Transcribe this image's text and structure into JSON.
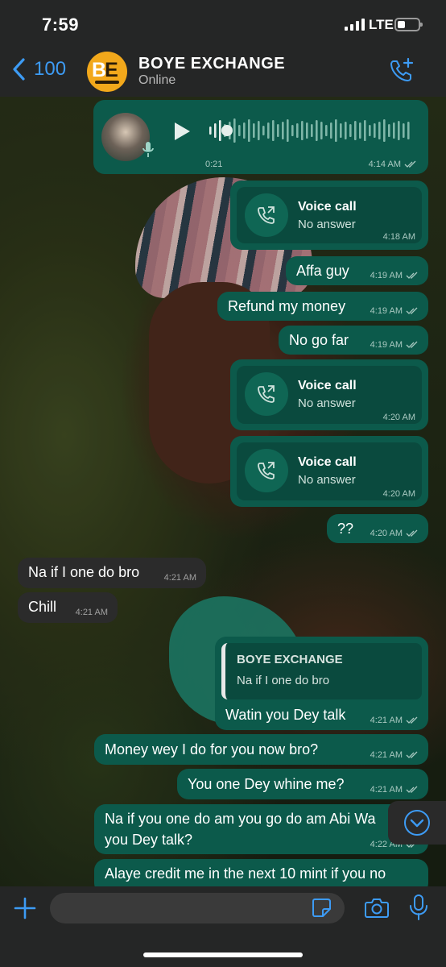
{
  "status": {
    "time": "7:59",
    "network": "LTE"
  },
  "header": {
    "back_count": "100",
    "name": "BOYE EXCHANGE",
    "status": "Online",
    "avatar_text": "BE"
  },
  "voice_note": {
    "duration": "0:21",
    "time": "4:14 AM"
  },
  "messages": {
    "call1": {
      "title": "Voice call",
      "sub": "No answer",
      "time": "4:18 AM"
    },
    "m1": {
      "text": "Affa guy",
      "time": "4:19 AM"
    },
    "m2": {
      "text": "Refund my money",
      "time": "4:19 AM"
    },
    "m3": {
      "text": "No go far",
      "time": "4:19 AM"
    },
    "call2": {
      "title": "Voice call",
      "sub": "No answer",
      "time": "4:20 AM"
    },
    "call3": {
      "title": "Voice call",
      "sub": "No answer",
      "time": "4:20 AM"
    },
    "m4": {
      "text": "??",
      "time": "4:20 AM"
    },
    "in1": {
      "text": "Na if I one do bro",
      "time": "4:21 AM"
    },
    "in2": {
      "text": "Chill",
      "time": "4:21 AM"
    },
    "reply": {
      "quoted_name": "BOYE EXCHANGE",
      "quoted_text": "Na if I one do bro",
      "text": "Watin you Dey talk",
      "time": "4:21 AM"
    },
    "m5": {
      "text": "Money wey I do for you now bro?",
      "time": "4:21 AM"
    },
    "m6": {
      "text": "You one Dey whine me?",
      "time": "4:21 AM"
    },
    "m7": {
      "line1": "Na if you one do am you go do am Abi Wa",
      "line2": "you Dey talk?",
      "time": "4:22 AM"
    },
    "m8": {
      "text": "Alaye credit me in the next 10 mint if you no"
    }
  },
  "colors": {
    "outgoing": "#0c5a4b",
    "incoming": "#2b2b2b",
    "accent": "#3d9bf4",
    "bar": "#252626"
  },
  "icons": [
    "chevron-left-icon",
    "call-add-icon",
    "play-icon",
    "mic-icon",
    "outgoing-call-icon",
    "double-check-icon",
    "chevron-down-icon",
    "plus-icon",
    "sticker-icon",
    "camera-icon"
  ]
}
